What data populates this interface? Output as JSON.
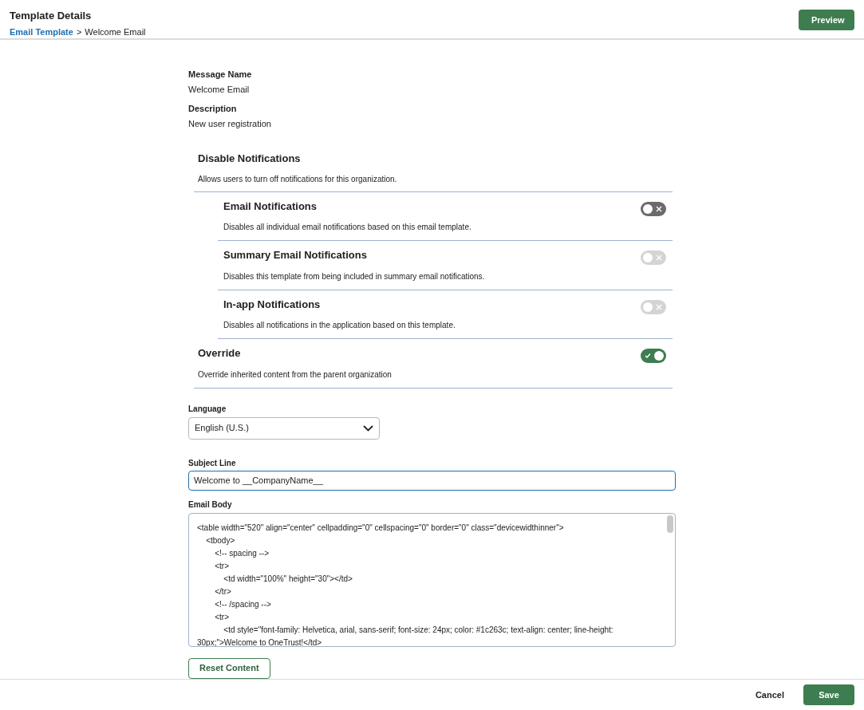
{
  "header": {
    "title": "Template Details",
    "breadcrumb": [
      {
        "label": "Email Template",
        "link": true
      },
      {
        "label": "Welcome Email",
        "link": false
      }
    ],
    "separator": ">",
    "preview_button": "Preview"
  },
  "fields": [
    {
      "label": "Message Name",
      "value": "Welcome Email"
    },
    {
      "label": "Description",
      "value": "New user registration"
    }
  ],
  "disable_notifications": {
    "title": "Disable Notifications",
    "description": "Allows users to turn off notifications for this organization.",
    "items": [
      {
        "title": "Email Notifications",
        "description": "Disables all individual email notifications based on this email template.",
        "on": false,
        "disabled": false
      },
      {
        "title": "Summary Email Notifications",
        "description": "Disables this template from being included in summary email notifications.",
        "on": false,
        "disabled": true
      },
      {
        "title": "In-app Notifications",
        "description": "Disables all notifications in the application based on this template.",
        "on": false,
        "disabled": true
      }
    ]
  },
  "override": {
    "title": "Override",
    "description": "Override inherited content from the parent organization",
    "on": true
  },
  "language": {
    "label": "Language",
    "value": "English (U.S.)"
  },
  "subject_line": {
    "label": "Subject Line",
    "value": "Welcome to __CompanyName__",
    "focused": true
  },
  "email_body": {
    "label": "Email Body",
    "lines": [
      "<table width=\"520\" align=\"center\" cellpadding=\"0\" cellspacing=\"0\" border=\"0\" class=\"devicewidthinner\">",
      "    <tbody>",
      "        <!-- spacing -->",
      "        <tr>",
      "            <td width=\"100%\" height=\"30\"></td>",
      "        </tr>",
      "        <!-- /spacing -->",
      "        <tr>",
      "            <td style=\"font-family: Helvetica, arial, sans-serif; font-size: 24px; color: #1c263c; text-align: center; line-height: 30px;\">Welcome to OneTrust!</td>"
    ]
  },
  "reset_button": "Reset Content",
  "footer": {
    "cancel": "Cancel",
    "save": "Save"
  }
}
